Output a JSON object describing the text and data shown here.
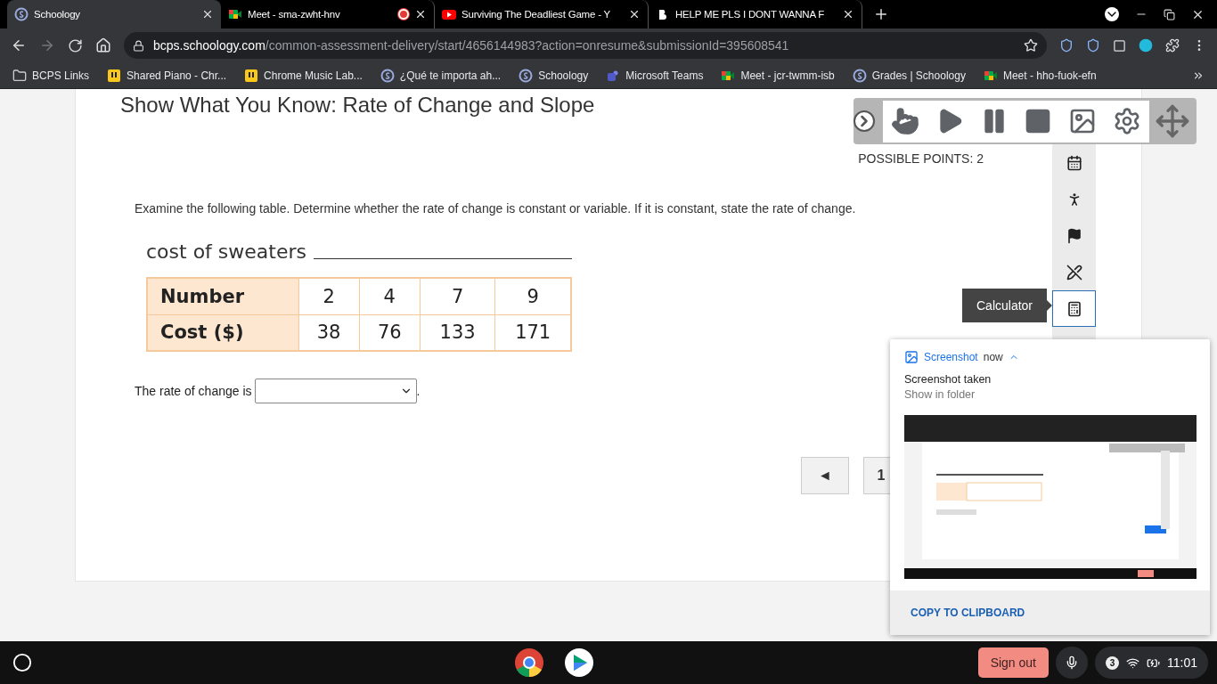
{
  "tabs": [
    {
      "title": "Schoology",
      "kind": "schoology",
      "selected": true,
      "recording": false
    },
    {
      "title": "Meet - sma-zwht-hnv",
      "kind": "meet",
      "selected": false,
      "recording": true
    },
    {
      "title": "Surviving The Deadliest Game - Y",
      "kind": "youtube",
      "selected": false,
      "recording": false
    },
    {
      "title": "HELP ME PLS I DONT WANNA F",
      "kind": "brainly",
      "selected": false,
      "recording": false
    }
  ],
  "address": {
    "host": "bcps.schoology.com",
    "path": "/common-assessment-delivery/start/4656144983?action=onresume&submissionId=395608541"
  },
  "bookmarks": [
    {
      "label": "BCPS Links",
      "kind": "folder"
    },
    {
      "label": "Shared Piano - Chr...",
      "kind": "piano"
    },
    {
      "label": "Chrome Music Lab...",
      "kind": "piano"
    },
    {
      "label": "¿Qué te importa ah...",
      "kind": "schoology"
    },
    {
      "label": "Schoology",
      "kind": "schoology"
    },
    {
      "label": "Microsoft Teams",
      "kind": "teams"
    },
    {
      "label": "Meet - jcr-twmm-isb",
      "kind": "meet"
    },
    {
      "label": "Grades | Schoology",
      "kind": "schoology"
    },
    {
      "label": "Meet - hho-fuok-efn",
      "kind": "meet"
    }
  ],
  "assessment": {
    "title": "Show What You Know: Rate of Change and Slope",
    "possible_points": "POSSIBLE POINTS: 2",
    "prompt": "Examine the following table. Determine whether the rate of change is constant or variable. If it is constant, state the rate of change.",
    "table": {
      "caption": "cost of sweaters",
      "rows": [
        [
          "Number",
          "2",
          "4",
          "7",
          "9"
        ],
        [
          "Cost ($)",
          "38",
          "76",
          "133",
          "171"
        ]
      ]
    },
    "answer_label": "The rate of change is",
    "answer_end": "."
  },
  "tool_rail": [
    {
      "kind": "calendar",
      "selected": false
    },
    {
      "kind": "accessibility",
      "selected": false
    },
    {
      "kind": "flag",
      "selected": false
    },
    {
      "kind": "strike",
      "selected": false
    },
    {
      "kind": "calculator",
      "selected": true
    }
  ],
  "tooltip": "Calculator",
  "pagination": {
    "prev": "◄",
    "pages": [
      "1"
    ]
  },
  "notification": {
    "app": "Screenshot",
    "time": "now",
    "title": "Screenshot taken",
    "subtitle": "Show in folder",
    "action": "COPY TO CLIPBOARD"
  },
  "shelf": {
    "sign_out": "Sign out",
    "badge": "3",
    "time": "11:01"
  }
}
